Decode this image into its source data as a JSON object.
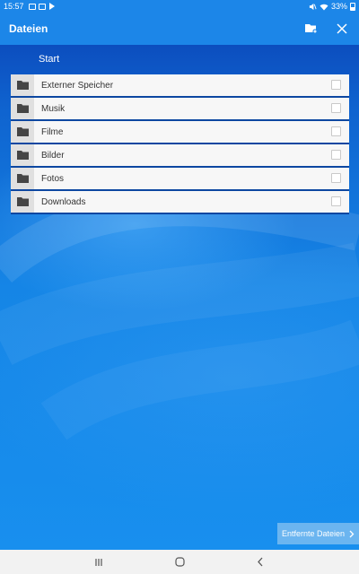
{
  "status_bar": {
    "time": "15:57",
    "battery": "33%"
  },
  "app_bar": {
    "title": "Dateien",
    "icons": [
      "new-folder-icon",
      "close-icon"
    ]
  },
  "path": {
    "current": "Start"
  },
  "folders": [
    {
      "label": "Externer Speicher",
      "icon": "folder-icon"
    },
    {
      "label": "Musik",
      "icon": "folder-icon"
    },
    {
      "label": "Filme",
      "icon": "folder-icon"
    },
    {
      "label": "Bilder",
      "icon": "folder-icon"
    },
    {
      "label": "Fotos",
      "icon": "folder-icon"
    },
    {
      "label": "Downloads",
      "icon": "folder-icon"
    }
  ],
  "remote_button": {
    "label": "Entfernte Dateien",
    "icon": "chevron-right-icon"
  },
  "nav_bar": {
    "icons": [
      "recents-icon",
      "home-icon",
      "back-icon"
    ]
  },
  "colors": {
    "app_bar": "#1c86e8",
    "row_separator": "#0d47a1",
    "row_bg": "#f7f7f7",
    "remote_button": "#6bb5f0"
  }
}
